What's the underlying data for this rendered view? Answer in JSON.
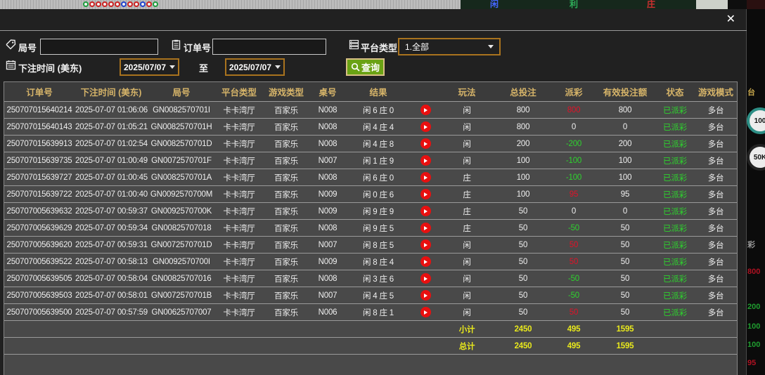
{
  "modal": {
    "close_glyph": "✕"
  },
  "filters": {
    "game_no": {
      "label": "局号",
      "value": ""
    },
    "order_no": {
      "label": "订单号",
      "value": ""
    },
    "platform": {
      "label": "平台类型",
      "value": "1.全部"
    },
    "bet_time": {
      "label": "下注时间 (美东)",
      "from": "2025/07/07",
      "to_separator": "至",
      "to": "2025/07/07"
    },
    "query": {
      "label": "查询"
    }
  },
  "table": {
    "headers": [
      "订单号",
      "下注时间 (美东)",
      "局号",
      "平台类型",
      "游戏类型",
      "桌号",
      "结果",
      "",
      "玩法",
      "总投注",
      "派彩",
      "有效投注额",
      "状态",
      "游戏模式"
    ],
    "rows": [
      {
        "order_no": "250707015640214",
        "bet_time": "2025-07-07 01:06:06",
        "game_no": "GN0082570701I",
        "platform": "卡卡湾厅",
        "game_type": "百家乐",
        "table_no": "N008",
        "result": "闲 6 庄 0",
        "bet_side": "闲",
        "total_bet": "800",
        "payout": "800",
        "payout_color": "red",
        "valid_bet": "800",
        "status": "已派彩",
        "mode": "多台"
      },
      {
        "order_no": "250707015640143",
        "bet_time": "2025-07-07 01:05:21",
        "game_no": "GN0082570701H",
        "platform": "卡卡湾厅",
        "game_type": "百家乐",
        "table_no": "N008",
        "result": "闲 4 庄 4",
        "bet_side": "闲",
        "total_bet": "800",
        "payout": "0",
        "payout_color": "white",
        "valid_bet": "0",
        "status": "已派彩",
        "mode": "多台"
      },
      {
        "order_no": "250707015639913",
        "bet_time": "2025-07-07 01:02:54",
        "game_no": "GN0082570701D",
        "platform": "卡卡湾厅",
        "game_type": "百家乐",
        "table_no": "N008",
        "result": "闲 4 庄 8",
        "bet_side": "闲",
        "total_bet": "200",
        "payout": "-200",
        "payout_color": "green",
        "valid_bet": "200",
        "status": "已派彩",
        "mode": "多台"
      },
      {
        "order_no": "250707015639735",
        "bet_time": "2025-07-07 01:00:49",
        "game_no": "GN0072570701F",
        "platform": "卡卡湾厅",
        "game_type": "百家乐",
        "table_no": "N007",
        "result": "闲 1 庄 9",
        "bet_side": "闲",
        "total_bet": "100",
        "payout": "-100",
        "payout_color": "green",
        "valid_bet": "100",
        "status": "已派彩",
        "mode": "多台"
      },
      {
        "order_no": "250707015639727",
        "bet_time": "2025-07-07 01:00:45",
        "game_no": "GN0082570701A",
        "platform": "卡卡湾厅",
        "game_type": "百家乐",
        "table_no": "N008",
        "result": "闲 6 庄 0",
        "bet_side": "庄",
        "total_bet": "100",
        "payout": "-100",
        "payout_color": "green",
        "valid_bet": "100",
        "status": "已派彩",
        "mode": "多台"
      },
      {
        "order_no": "250707015639722",
        "bet_time": "2025-07-07 01:00:40",
        "game_no": "GN0092570700M",
        "platform": "卡卡湾厅",
        "game_type": "百家乐",
        "table_no": "N009",
        "result": "闲 0 庄 6",
        "bet_side": "庄",
        "total_bet": "100",
        "payout": "95",
        "payout_color": "red",
        "valid_bet": "95",
        "status": "已派彩",
        "mode": "多台"
      },
      {
        "order_no": "250707005639632",
        "bet_time": "2025-07-07 00:59:37",
        "game_no": "GN0092570700K",
        "platform": "卡卡湾厅",
        "game_type": "百家乐",
        "table_no": "N009",
        "result": "闲 9 庄 9",
        "bet_side": "庄",
        "total_bet": "50",
        "payout": "0",
        "payout_color": "white",
        "valid_bet": "0",
        "status": "已派彩",
        "mode": "多台"
      },
      {
        "order_no": "250707005639629",
        "bet_time": "2025-07-07 00:59:34",
        "game_no": "GN00825707018",
        "platform": "卡卡湾厅",
        "game_type": "百家乐",
        "table_no": "N008",
        "result": "闲 9 庄 5",
        "bet_side": "庄",
        "total_bet": "50",
        "payout": "-50",
        "payout_color": "green",
        "valid_bet": "50",
        "status": "已派彩",
        "mode": "多台"
      },
      {
        "order_no": "250707005639620",
        "bet_time": "2025-07-07 00:59:31",
        "game_no": "GN0072570701D",
        "platform": "卡卡湾厅",
        "game_type": "百家乐",
        "table_no": "N007",
        "result": "闲 8 庄 5",
        "bet_side": "闲",
        "total_bet": "50",
        "payout": "50",
        "payout_color": "red",
        "valid_bet": "50",
        "status": "已派彩",
        "mode": "多台"
      },
      {
        "order_no": "250707005639522",
        "bet_time": "2025-07-07 00:58:13",
        "game_no": "GN0092570700I",
        "platform": "卡卡湾厅",
        "game_type": "百家乐",
        "table_no": "N009",
        "result": "闲 8 庄 4",
        "bet_side": "闲",
        "total_bet": "50",
        "payout": "50",
        "payout_color": "red",
        "valid_bet": "50",
        "status": "已派彩",
        "mode": "多台"
      },
      {
        "order_no": "250707005639505",
        "bet_time": "2025-07-07 00:58:04",
        "game_no": "GN00825707016",
        "platform": "卡卡湾厅",
        "game_type": "百家乐",
        "table_no": "N008",
        "result": "闲 3 庄 6",
        "bet_side": "闲",
        "total_bet": "50",
        "payout": "-50",
        "payout_color": "green",
        "valid_bet": "50",
        "status": "已派彩",
        "mode": "多台"
      },
      {
        "order_no": "250707005639503",
        "bet_time": "2025-07-07 00:58:01",
        "game_no": "GN0072570701B",
        "platform": "卡卡湾厅",
        "game_type": "百家乐",
        "table_no": "N007",
        "result": "闲 4 庄 5",
        "bet_side": "闲",
        "total_bet": "50",
        "payout": "-50",
        "payout_color": "green",
        "valid_bet": "50",
        "status": "已派彩",
        "mode": "多台"
      },
      {
        "order_no": "250707005639500",
        "bet_time": "2025-07-07 00:57:59",
        "game_no": "GN00625707007",
        "platform": "卡卡湾厅",
        "game_type": "百家乐",
        "table_no": "N006",
        "result": "闲 8 庄 1",
        "bet_side": "闲",
        "total_bet": "50",
        "payout": "50",
        "payout_color": "red",
        "valid_bet": "50",
        "status": "已派彩",
        "mode": "多台"
      }
    ],
    "subtotal": {
      "label": "小计",
      "total_bet": "2450",
      "payout": "495",
      "valid_bet": "1595"
    },
    "grand_total": {
      "label": "总计",
      "total_bet": "2450",
      "payout": "495",
      "valid_bet": "1595"
    }
  },
  "background": {
    "top_road_circles": [
      "green",
      "red",
      "red",
      "red",
      "red",
      "red",
      "blue",
      "red",
      "red",
      "blue",
      "red",
      "green"
    ],
    "top_road_chars": [
      {
        "text": "闲",
        "color": "#4466ff"
      },
      {
        "text": "利",
        "color": "#2fae5a"
      },
      {
        "text": "庄",
        "color": "#d03030"
      }
    ],
    "right_fragments": [
      {
        "text": "台",
        "kind": "text",
        "color": "#c9a84c"
      },
      {
        "text": "100",
        "kind": "chip",
        "ring": "#2e8f86"
      },
      {
        "text": "50K",
        "kind": "chip",
        "ring": "#222222"
      },
      {
        "text": "彩",
        "kind": "text",
        "color": "#9a9a9a"
      },
      {
        "text": "800",
        "kind": "text",
        "color": "#b01122"
      },
      {
        "text": "200",
        "kind": "text",
        "color": "#1f9d2f"
      },
      {
        "text": "100",
        "kind": "text",
        "color": "#1f9d2f"
      },
      {
        "text": "100",
        "kind": "text",
        "color": "#1f9d2f"
      },
      {
        "text": "95",
        "kind": "text",
        "color": "#b01122"
      }
    ]
  },
  "colors": {
    "payout_red": "#e01228",
    "payout_green": "#2ed22e",
    "status_green": "#2ed22e",
    "totals_yellow": "#e9e91c",
    "header_gold": "#d6b469",
    "query_green": "#6aa214",
    "select_border_orange": "#a9731e"
  }
}
